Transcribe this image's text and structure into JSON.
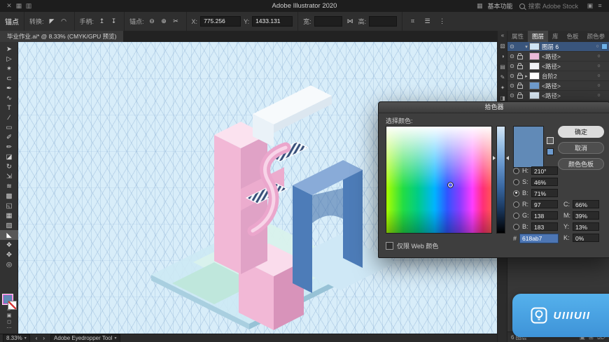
{
  "titlebar": {
    "title": "Adobe Illustrator 2020",
    "workspace": "基本功能",
    "search": "搜索 Adobe Stock",
    "left_icons": [
      {
        "name": "close-icon",
        "glyph": "✕"
      },
      {
        "name": "grid-icon",
        "glyph": "▦"
      },
      {
        "name": "layout-icon",
        "glyph": "▥"
      }
    ],
    "right_icons": [
      {
        "name": "arrange-icon",
        "glyph": "▣"
      },
      {
        "name": "menu-icon",
        "glyph": "≡"
      }
    ]
  },
  "controlbar": {
    "anchor": "锚点",
    "convert": "转换:",
    "handles": "手柄:",
    "anchors": "锚点:",
    "x_label": "X:",
    "x_value": "775.256",
    "y_label": "Y:",
    "y_value": "1433.131",
    "w_label": "宽:",
    "w_value": "",
    "h_label": "高:",
    "h_value": "",
    "convert_icons": [
      {
        "name": "convert-to-corner-icon",
        "glyph": "◤"
      },
      {
        "name": "convert-to-smooth-icon",
        "glyph": "◠"
      }
    ],
    "handle_icons": [
      {
        "name": "show-handles-icon",
        "glyph": "↥"
      },
      {
        "name": "hide-handles-icon",
        "glyph": "↧"
      }
    ],
    "anchor_icons": [
      {
        "name": "remove-anchor-icon",
        "glyph": "⊖"
      },
      {
        "name": "add-anchor-icon",
        "glyph": "⊕"
      },
      {
        "name": "cut-path-icon",
        "glyph": "✂"
      }
    ],
    "right_icons": [
      {
        "name": "snap-grid-icon",
        "glyph": "⌗"
      },
      {
        "name": "options-icon",
        "glyph": "☰"
      },
      {
        "name": "more-options-icon",
        "glyph": "⋮"
      }
    ]
  },
  "doctab": {
    "title": "毕业作业.ai* @ 8.33% (CMYK/GPU 预览)"
  },
  "tools": [
    {
      "name": "selection-tool",
      "glyph": "➤"
    },
    {
      "name": "direct-selection-tool",
      "glyph": "▷"
    },
    {
      "name": "magic-wand-tool",
      "glyph": "✶"
    },
    {
      "name": "lasso-tool",
      "glyph": "⊂"
    },
    {
      "name": "pen-tool",
      "glyph": "✒"
    },
    {
      "name": "curvature-tool",
      "glyph": "∿"
    },
    {
      "name": "type-tool",
      "glyph": "T"
    },
    {
      "name": "line-segment-tool",
      "glyph": "∕"
    },
    {
      "name": "rectangle-tool",
      "glyph": "▭"
    },
    {
      "name": "paintbrush-tool",
      "glyph": "✐"
    },
    {
      "name": "pencil-tool",
      "glyph": "✏"
    },
    {
      "name": "eraser-tool",
      "glyph": "◪"
    },
    {
      "name": "rotate-tool",
      "glyph": "↻"
    },
    {
      "name": "scale-tool",
      "glyph": "⇲"
    },
    {
      "name": "width-tool",
      "glyph": "≋"
    },
    {
      "name": "free-transform-tool",
      "glyph": "▩"
    },
    {
      "name": "shape-builder-tool",
      "glyph": "◱"
    },
    {
      "name": "mesh-tool",
      "glyph": "▦"
    },
    {
      "name": "gradient-tool",
      "glyph": "▨"
    },
    {
      "name": "eyedropper-tool",
      "glyph": "◣",
      "active": true
    },
    {
      "name": "blend-tool",
      "glyph": "❖"
    },
    {
      "name": "hand-tool",
      "glyph": "✥"
    },
    {
      "name": "zoom-tool",
      "glyph": "◎"
    }
  ],
  "dock_icons": [
    {
      "name": "expand-panels-icon",
      "glyph": "«"
    },
    {
      "name": "color-panel-icon",
      "glyph": "▧"
    },
    {
      "name": "color-guide-panel-icon",
      "glyph": "◑"
    },
    {
      "name": "swatches-panel-icon",
      "glyph": "▤"
    },
    {
      "name": "brushes-panel-icon",
      "glyph": "✎"
    },
    {
      "name": "symbols-panel-icon",
      "glyph": "✦"
    },
    {
      "name": "libraries-panel-icon",
      "glyph": "◨"
    }
  ],
  "panel": {
    "tabs": [
      {
        "label": "属性",
        "active": false
      },
      {
        "label": "图层",
        "active": true
      },
      {
        "label": "库",
        "active": false
      },
      {
        "label": "色板",
        "active": false
      },
      {
        "label": "颜色参",
        "active": false
      }
    ],
    "layers": [
      {
        "name": "图层 6",
        "selected": true,
        "expanded": true,
        "locked": false,
        "thumb": "#cfe3f2"
      },
      {
        "name": "<路径>",
        "selected": false,
        "locked": true,
        "thumb": "#e9b9d8"
      },
      {
        "name": "<路径>",
        "selected": false,
        "locked": true,
        "thumb": "#f0f3f7"
      },
      {
        "name": "台阶2",
        "selected": false,
        "group": true,
        "locked": true,
        "thumb": "#ffffff"
      },
      {
        "name": "<路径>",
        "selected": false,
        "locked": true,
        "thumb": "#6f9ccd"
      },
      {
        "name": "<路径>",
        "selected": false,
        "locked": true,
        "thumb": "#dcebf7"
      }
    ],
    "footer_count": "6 图层",
    "footer_icons": [
      {
        "name": "collect-layers-icon",
        "glyph": "▣"
      },
      {
        "name": "new-layer-icon",
        "glyph": "⊞"
      },
      {
        "name": "delete-layer-icon",
        "glyph": "⌦"
      }
    ]
  },
  "picker": {
    "title": "拾色器",
    "select_label": "选择颜色:",
    "buttons": {
      "ok": "确定",
      "cancel": "取消",
      "swatches": "颜色色板"
    },
    "fields": [
      {
        "label": "H:",
        "value": "210°",
        "selected": false
      },
      {
        "label": "S:",
        "value": "46%",
        "selected": false
      },
      {
        "label": "B:",
        "value": "71%",
        "selected": true
      },
      {
        "label": "R:",
        "value": "97",
        "selected": false
      },
      {
        "label": "G:",
        "value": "138",
        "selected": false
      },
      {
        "label": "B:",
        "value": "183",
        "selected": false
      }
    ],
    "cmyk": [
      {
        "label": "C:",
        "value": "66%"
      },
      {
        "label": "M:",
        "value": "39%"
      },
      {
        "label": "Y:",
        "value": "13%"
      },
      {
        "label": "K:",
        "value": "0%"
      }
    ],
    "hex_label": "#",
    "hex_value": "618ab7",
    "web_only_label": "仅限 Web 颜色",
    "current_color": "#618ab7"
  },
  "statusbar": {
    "zoom": "8.33%",
    "tool_label": "Adobe Eyedropper Tool"
  },
  "watermark": "UIIIUII"
}
